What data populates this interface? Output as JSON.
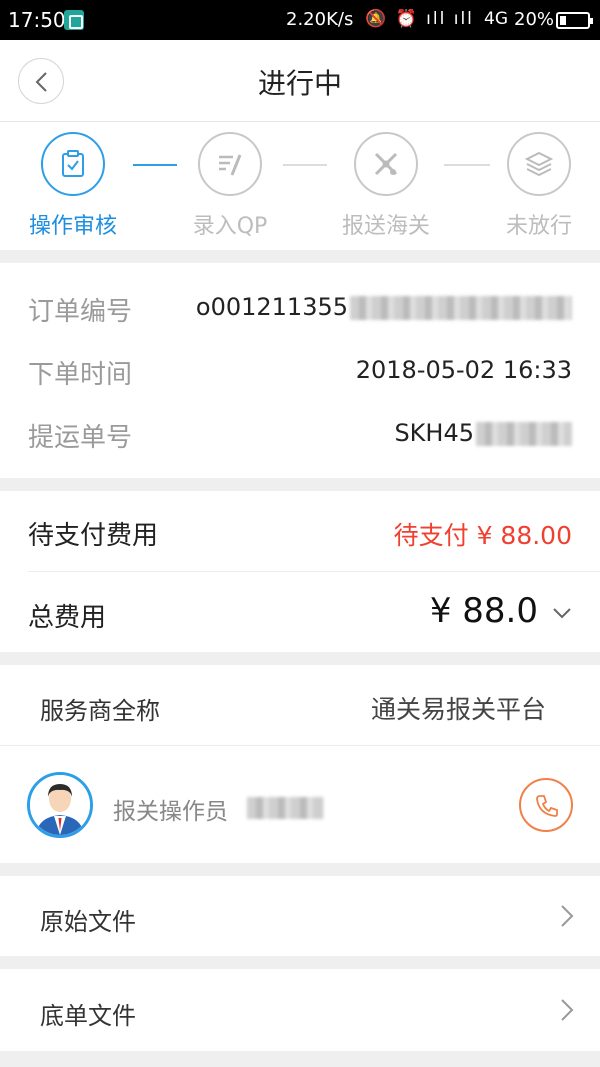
{
  "status_bar": {
    "time": "17:50",
    "net_speed": "2.20K/s",
    "icons": "🔕 ⏰ ıll ıll",
    "network": "4G",
    "battery": "20%"
  },
  "header": {
    "title": "进行中"
  },
  "steps": [
    {
      "label": "操作审核",
      "icon": "clipboard-check-icon",
      "active": true
    },
    {
      "label": "录入QP",
      "icon": "edit-list-icon",
      "active": false
    },
    {
      "label": "报送海关",
      "icon": "satellite-icon",
      "active": false
    },
    {
      "label": "未放行",
      "icon": "layers-icon",
      "active": false
    }
  ],
  "order": {
    "order_no_label": "订单编号",
    "order_no_value": "o001211355",
    "order_time_label": "下单时间",
    "order_time_value": "2018-05-02 16:33",
    "bill_no_label": "提运单号",
    "bill_no_value": "SKH45"
  },
  "fees": {
    "pending_label": "待支付费用",
    "pending_value": "待支付 ¥ 88.00",
    "total_label": "总费用",
    "total_value": "¥ 88.0"
  },
  "provider": {
    "name_label": "服务商全称",
    "name_value": "通关易报关平台",
    "operator_label": "报关操作员"
  },
  "files": {
    "original_label": "原始文件",
    "bottom_label": "底单文件"
  },
  "colors": {
    "accent": "#2d9ee8",
    "price": "#f0402f",
    "phone": "#f08048"
  }
}
